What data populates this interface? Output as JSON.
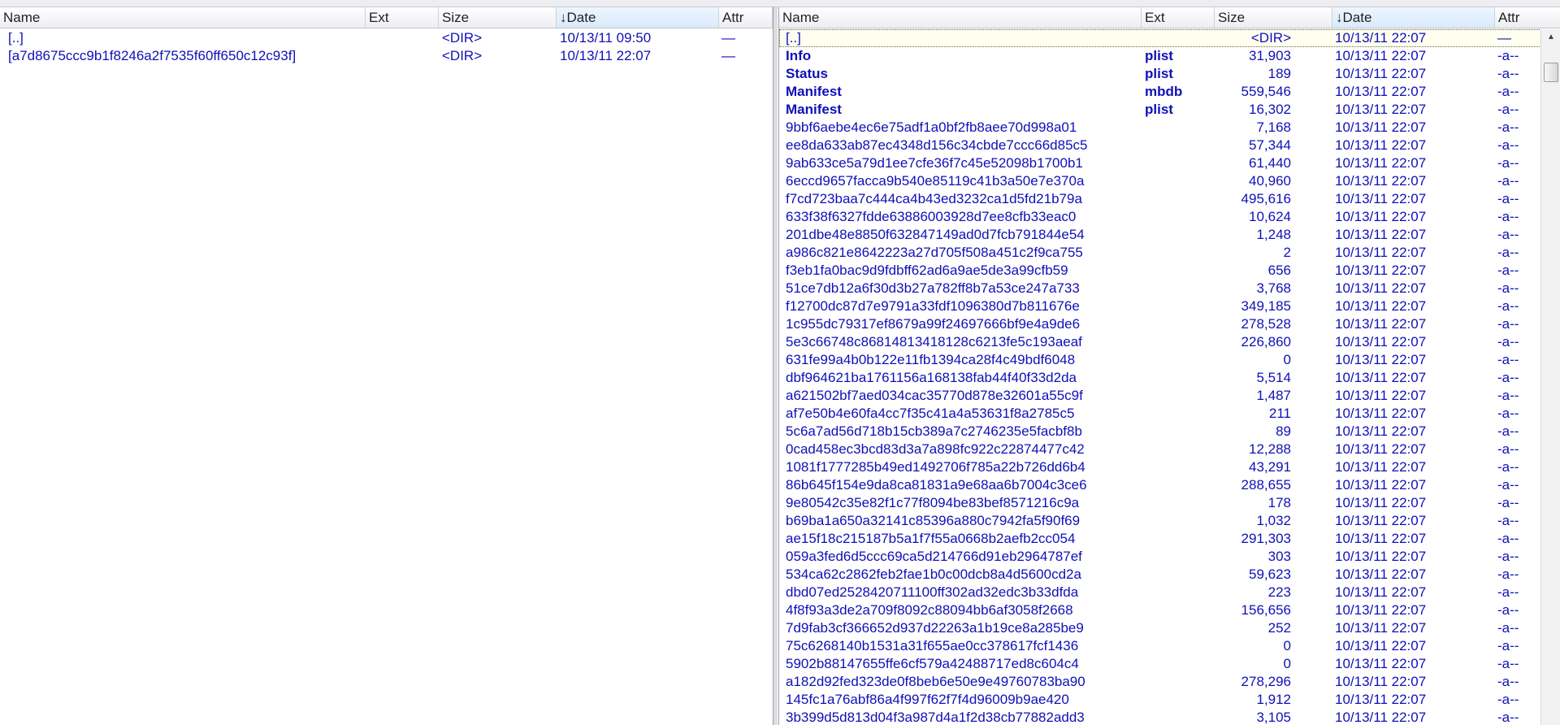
{
  "columns": {
    "name": "Name",
    "ext": "Ext",
    "size": "Size",
    "date": "Date",
    "attr": "Attr",
    "sort_arrow": "↓"
  },
  "left_panel": {
    "rows": [
      {
        "name": "[..]",
        "ext": "",
        "size": "<DIR>",
        "date": "10/13/11 09:50",
        "attr": "—"
      },
      {
        "name": "[a7d8675ccc9b1f8246a2f7535f60ff650c12c93f]",
        "ext": "",
        "size": "<DIR>",
        "date": "10/13/11 22:07",
        "attr": "—"
      }
    ]
  },
  "right_panel": {
    "scroll_up": "▲",
    "rows": [
      {
        "name": "[..]",
        "ext": "",
        "size": "<DIR>",
        "date": "10/13/11 22:07",
        "attr": "—"
      },
      {
        "name": "Info",
        "ext": "plist",
        "size": "31,903",
        "date": "10/13/11 22:07",
        "attr": "-a--"
      },
      {
        "name": "Status",
        "ext": "plist",
        "size": "189",
        "date": "10/13/11 22:07",
        "attr": "-a--"
      },
      {
        "name": "Manifest",
        "ext": "mbdb",
        "size": "559,546",
        "date": "10/13/11 22:07",
        "attr": "-a--"
      },
      {
        "name": "Manifest",
        "ext": "plist",
        "size": "16,302",
        "date": "10/13/11 22:07",
        "attr": "-a--"
      },
      {
        "name": "9bbf6aebe4ec6e75adf1a0bf2fb8aee70d998a01",
        "ext": "",
        "size": "7,168",
        "date": "10/13/11 22:07",
        "attr": "-a--"
      },
      {
        "name": "ee8da633ab87ec4348d156c34cbde7ccc66d85c5",
        "ext": "",
        "size": "57,344",
        "date": "10/13/11 22:07",
        "attr": "-a--"
      },
      {
        "name": "9ab633ce5a79d1ee7cfe36f7c45e52098b1700b1",
        "ext": "",
        "size": "61,440",
        "date": "10/13/11 22:07",
        "attr": "-a--"
      },
      {
        "name": "6eccd9657facca9b540e85119c41b3a50e7e370a",
        "ext": "",
        "size": "40,960",
        "date": "10/13/11 22:07",
        "attr": "-a--"
      },
      {
        "name": "f7cd723baa7c444ca4b43ed3232ca1d5fd21b79a",
        "ext": "",
        "size": "495,616",
        "date": "10/13/11 22:07",
        "attr": "-a--"
      },
      {
        "name": "633f38f6327fdde63886003928d7ee8cfb33eac0",
        "ext": "",
        "size": "10,624",
        "date": "10/13/11 22:07",
        "attr": "-a--"
      },
      {
        "name": "201dbe48e8850f632847149ad0d7fcb791844e54",
        "ext": "",
        "size": "1,248",
        "date": "10/13/11 22:07",
        "attr": "-a--"
      },
      {
        "name": "a986c821e8642223a27d705f508a451c2f9ca755",
        "ext": "",
        "size": "2",
        "date": "10/13/11 22:07",
        "attr": "-a--"
      },
      {
        "name": "f3eb1fa0bac9d9fdbff62ad6a9ae5de3a99cfb59",
        "ext": "",
        "size": "656",
        "date": "10/13/11 22:07",
        "attr": "-a--"
      },
      {
        "name": "51ce7db12a6f30d3b27a782ff8b7a53ce247a733",
        "ext": "",
        "size": "3,768",
        "date": "10/13/11 22:07",
        "attr": "-a--"
      },
      {
        "name": "f12700dc87d7e9791a33fdf1096380d7b811676e",
        "ext": "",
        "size": "349,185",
        "date": "10/13/11 22:07",
        "attr": "-a--"
      },
      {
        "name": "1c955dc79317ef8679a99f24697666bf9e4a9de6",
        "ext": "",
        "size": "278,528",
        "date": "10/13/11 22:07",
        "attr": "-a--"
      },
      {
        "name": "5e3c66748c86814813418128c6213fe5c193aeaf",
        "ext": "",
        "size": "226,860",
        "date": "10/13/11 22:07",
        "attr": "-a--"
      },
      {
        "name": "631fe99a4b0b122e11fb1394ca28f4c49bdf6048",
        "ext": "",
        "size": "0",
        "date": "10/13/11 22:07",
        "attr": "-a--"
      },
      {
        "name": "dbf964621ba1761156a168138fab44f40f33d2da",
        "ext": "",
        "size": "5,514",
        "date": "10/13/11 22:07",
        "attr": "-a--"
      },
      {
        "name": "a621502bf7aed034cac35770d878e32601a55c9f",
        "ext": "",
        "size": "1,487",
        "date": "10/13/11 22:07",
        "attr": "-a--"
      },
      {
        "name": "af7e50b4e60fa4cc7f35c41a4a53631f8a2785c5",
        "ext": "",
        "size": "211",
        "date": "10/13/11 22:07",
        "attr": "-a--"
      },
      {
        "name": "5c6a7ad56d718b15cb389a7c2746235e5facbf8b",
        "ext": "",
        "size": "89",
        "date": "10/13/11 22:07",
        "attr": "-a--"
      },
      {
        "name": "0cad458ec3bcd83d3a7a898fc922c22874477c42",
        "ext": "",
        "size": "12,288",
        "date": "10/13/11 22:07",
        "attr": "-a--"
      },
      {
        "name": "1081f1777285b49ed1492706f785a22b726dd6b4",
        "ext": "",
        "size": "43,291",
        "date": "10/13/11 22:07",
        "attr": "-a--"
      },
      {
        "name": "86b645f154e9da8ca81831a9e68aa6b7004c3ce6",
        "ext": "",
        "size": "288,655",
        "date": "10/13/11 22:07",
        "attr": "-a--"
      },
      {
        "name": "9e80542c35e82f1c77f8094be83bef8571216c9a",
        "ext": "",
        "size": "178",
        "date": "10/13/11 22:07",
        "attr": "-a--"
      },
      {
        "name": "b69ba1a650a32141c85396a880c7942fa5f90f69",
        "ext": "",
        "size": "1,032",
        "date": "10/13/11 22:07",
        "attr": "-a--"
      },
      {
        "name": "ae15f18c215187b5a1f7f55a0668b2aefb2cc054",
        "ext": "",
        "size": "291,303",
        "date": "10/13/11 22:07",
        "attr": "-a--"
      },
      {
        "name": "059a3fed6d5ccc69ca5d214766d91eb2964787ef",
        "ext": "",
        "size": "303",
        "date": "10/13/11 22:07",
        "attr": "-a--"
      },
      {
        "name": "534ca62c2862feb2fae1b0c00dcb8a4d5600cd2a",
        "ext": "",
        "size": "59,623",
        "date": "10/13/11 22:07",
        "attr": "-a--"
      },
      {
        "name": "dbd07ed2528420711100ff302ad32edc3b33dfda",
        "ext": "",
        "size": "223",
        "date": "10/13/11 22:07",
        "attr": "-a--"
      },
      {
        "name": "4f8f93a3de2a709f8092c88094bb6af3058f2668",
        "ext": "",
        "size": "156,656",
        "date": "10/13/11 22:07",
        "attr": "-a--"
      },
      {
        "name": "7d9fab3cf366652d937d22263a1b19ce8a285be9",
        "ext": "",
        "size": "252",
        "date": "10/13/11 22:07",
        "attr": "-a--"
      },
      {
        "name": "75c6268140b1531a31f655ae0cc378617fcf1436",
        "ext": "",
        "size": "0",
        "date": "10/13/11 22:07",
        "attr": "-a--"
      },
      {
        "name": "5902b88147655ffe6cf579a42488717ed8c604c4",
        "ext": "",
        "size": "0",
        "date": "10/13/11 22:07",
        "attr": "-a--"
      },
      {
        "name": "a182d92fed323de0f8beb6e50e9e49760783ba90",
        "ext": "",
        "size": "278,296",
        "date": "10/13/11 22:07",
        "attr": "-a--"
      },
      {
        "name": "145fc1a76abf86a4f997f62f7f4d96009b9ae420",
        "ext": "",
        "size": "1,912",
        "date": "10/13/11 22:07",
        "attr": "-a--"
      },
      {
        "name": "3b399d5d813d04f3a987d4a1f2d38cb77882add3",
        "ext": "",
        "size": "3,105",
        "date": "10/13/11 22:07",
        "attr": "-a--"
      }
    ]
  }
}
